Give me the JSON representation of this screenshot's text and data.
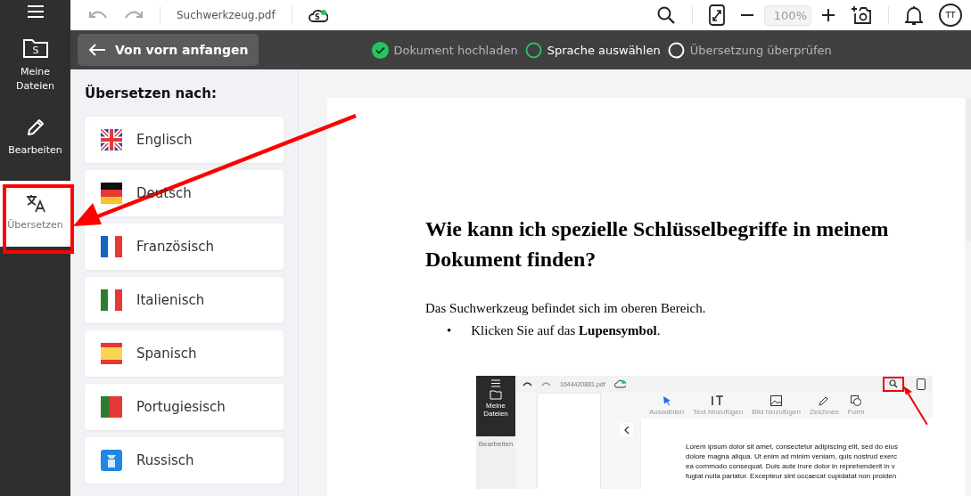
{
  "toolbar": {
    "file_name": "Suchwerkzeug.pdf",
    "cloud_badge": "S",
    "zoom": "100%",
    "avatar": "TT"
  },
  "sidebar": {
    "items": [
      {
        "label": "Meine Dateien",
        "icon_letter": "S",
        "selected": false
      },
      {
        "label": "Bearbeiten",
        "selected": false
      },
      {
        "label": "Übersetzen",
        "selected": true
      }
    ]
  },
  "steps_bar": {
    "back_button": "Von vorn anfangen",
    "steps": [
      {
        "label": "Dokument hochladen",
        "done": true,
        "selected": false
      },
      {
        "label": "Sprache auswählen",
        "done": false,
        "selected": true
      },
      {
        "label": "Übersetzung überprüfen",
        "done": false,
        "selected": false
      }
    ]
  },
  "language_panel": {
    "title": "Übersetzen nach:",
    "languages": [
      {
        "label": "Englisch",
        "kind": "uk"
      },
      {
        "label": "Deutsch",
        "kind": "de"
      },
      {
        "label": "Französisch",
        "kind": "fr"
      },
      {
        "label": "Italienisch",
        "kind": "it"
      },
      {
        "label": "Spanisch",
        "kind": "es"
      },
      {
        "label": "Portugiesisch",
        "kind": "pt"
      },
      {
        "label": "Russisch",
        "kind": "ru"
      }
    ]
  },
  "document": {
    "heading": "Wie kann ich spezielle Schlüsselbegriffe in meinem Dokument finden?",
    "paragraph": "Das Suchwerkzeug befindet sich im oberen Bereich.",
    "bullets": [
      {
        "marker": "•",
        "text": "Klicken Sie auf das **Lupensymbol**."
      }
    ],
    "embedded_screenshot": {
      "file_name": "1644420881.pdf",
      "sidebar_items": [
        "Meine Dateien",
        "Bearbeiten"
      ],
      "tools": [
        "Auswählen",
        "Text hinzufügen",
        "Bild hinzufügen",
        "Zeichnen",
        "Form"
      ],
      "lines": [
        "Lorem ipsum dolor sit amet, consectetur adipiscing elit, sed do eius",
        "dolore magna aliqua. Ut enim ad minim veniam, quis nostrud exerc",
        "ea commodo consequat. Duis aute irure dolor in reprehenderit in v",
        "fugiat nulla pariatur. Excepteur sint occaecat cupidatat non proiden"
      ]
    }
  }
}
